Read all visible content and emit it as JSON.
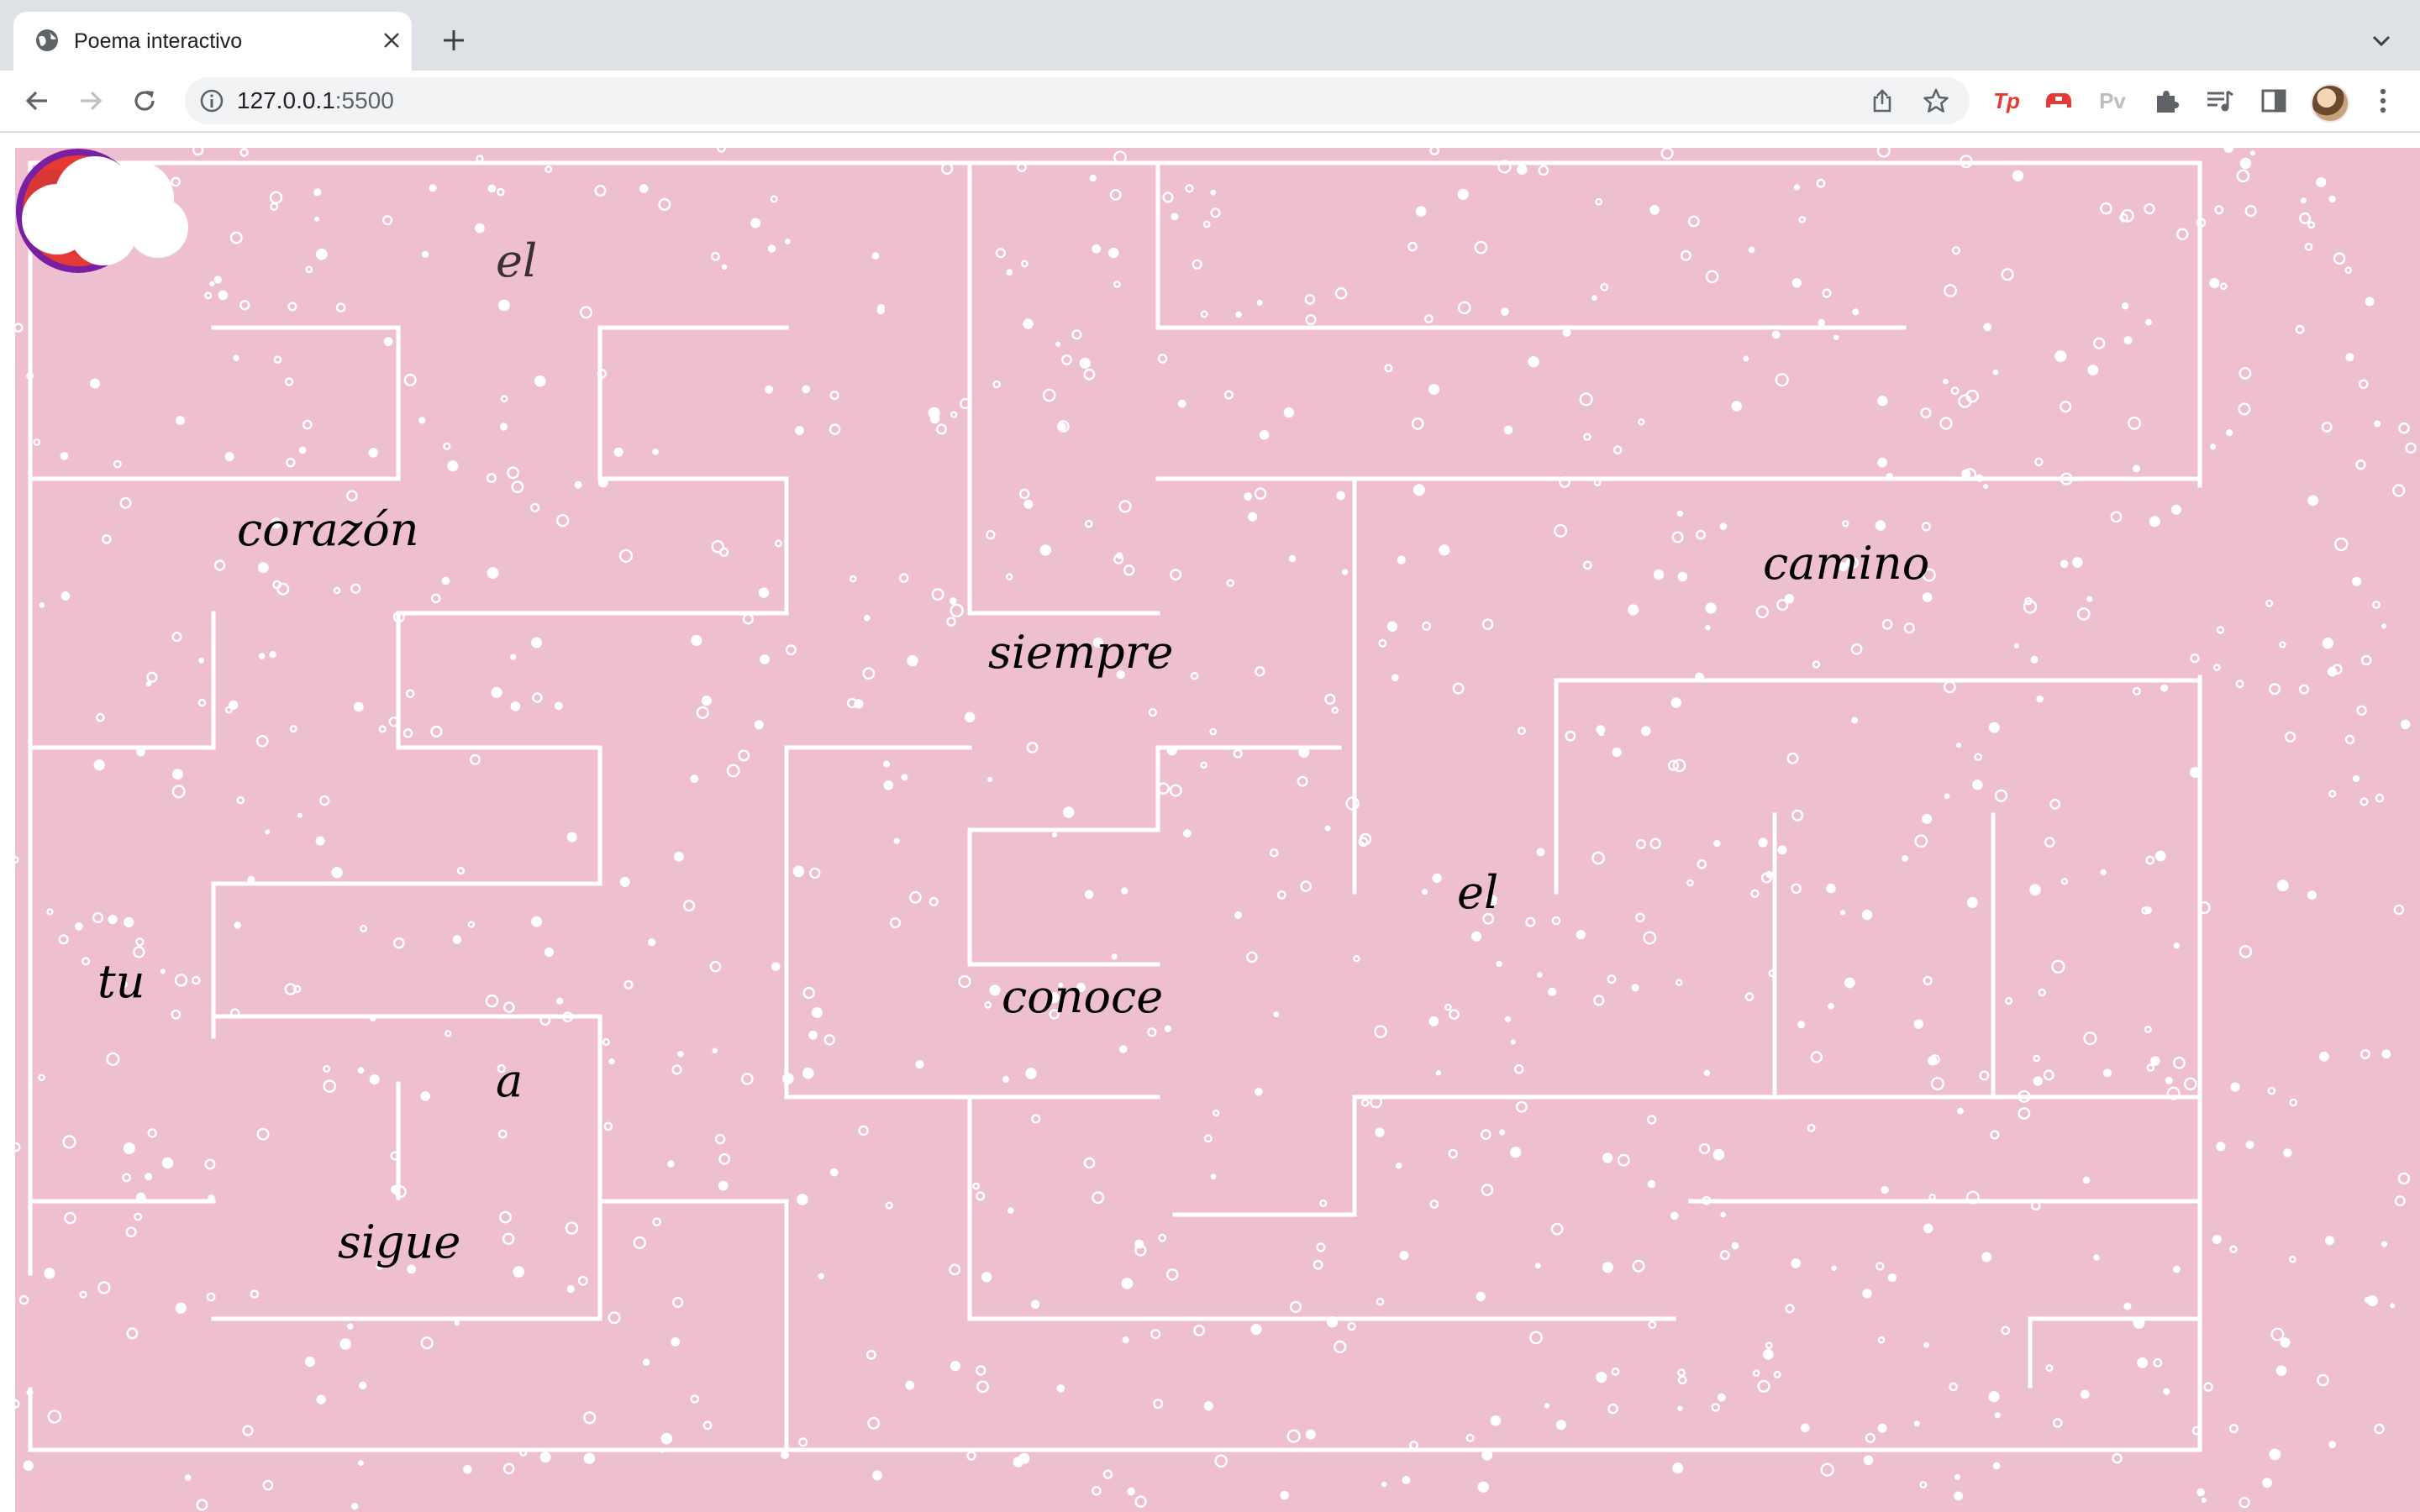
{
  "browser": {
    "tab_title": "Poema interactivo",
    "url_host": "127.0.0.1",
    "url_port": ":5500",
    "extensions": [
      {
        "name": "tp-extension-icon",
        "label": "Tp",
        "color": "#e53935"
      },
      {
        "name": "red-extension-icon",
        "label": "",
        "color": "#e53935"
      },
      {
        "name": "pv-extension-icon",
        "label": "Pv",
        "color": "#bdbdbd"
      }
    ]
  },
  "game": {
    "background_color": "#eebfd1",
    "wall_color": "#ffffff",
    "words": {
      "w1": "el",
      "w2": "corazón",
      "w3": "tu",
      "w4": "a",
      "w5": "sigue",
      "w6": "siempre",
      "w7": "conoce",
      "w8": "el",
      "w9": "camino"
    },
    "player": {
      "icon": "heart-icon",
      "ring_color": "#7b1fa2",
      "heart_color": "#e53935",
      "dot_color": "#c6c66a"
    },
    "goal": {
      "icon": "cloud-icon",
      "color": "#ffffff"
    }
  }
}
